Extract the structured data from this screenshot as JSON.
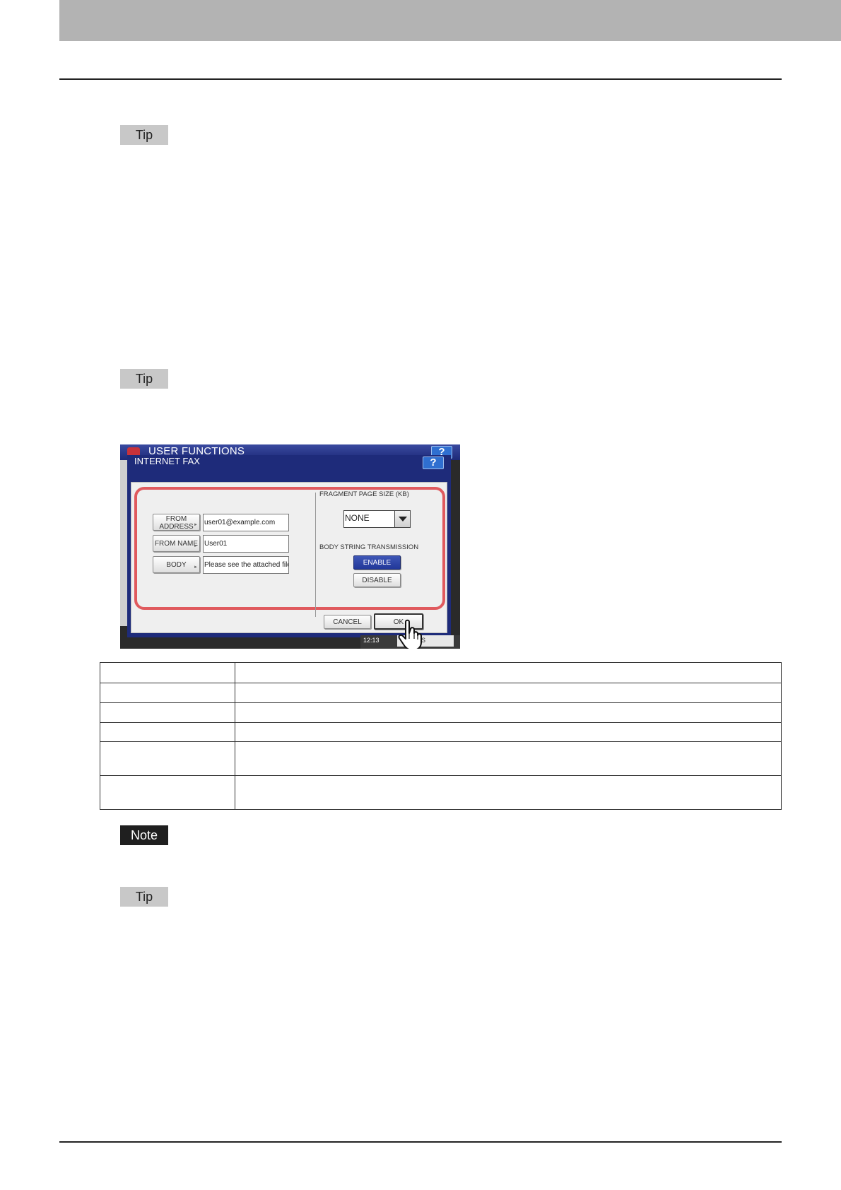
{
  "page": {
    "tags": {
      "tip": "Tip",
      "note": "Note"
    }
  },
  "screen": {
    "app_title": "USER FUNCTIONS",
    "dialog_title": "INTERNET FAX",
    "help_label": "?",
    "from_address_button": "FROM ADDRESS",
    "from_address_value": "user01@example.com",
    "from_name_button": "FROM NAME",
    "from_name_value": "User01",
    "body_button": "BODY",
    "body_value": "Please see the attached file fo",
    "fragment_label": "FRAGMENT PAGE SIZE (KB)",
    "fragment_value": "NONE",
    "body_string_label": "BODY STRING TRANSMISSION",
    "enable_button": "ENABLE",
    "disable_button": "DISABLE",
    "cancel_button": "CANCEL",
    "ok_button": "OK",
    "clock": "12:13",
    "job_button": "JOB S"
  },
  "table": {
    "rows": [
      [
        "",
        ""
      ],
      [
        "",
        ""
      ],
      [
        "",
        ""
      ],
      [
        "",
        ""
      ],
      [
        "",
        ""
      ],
      [
        "",
        ""
      ]
    ]
  }
}
